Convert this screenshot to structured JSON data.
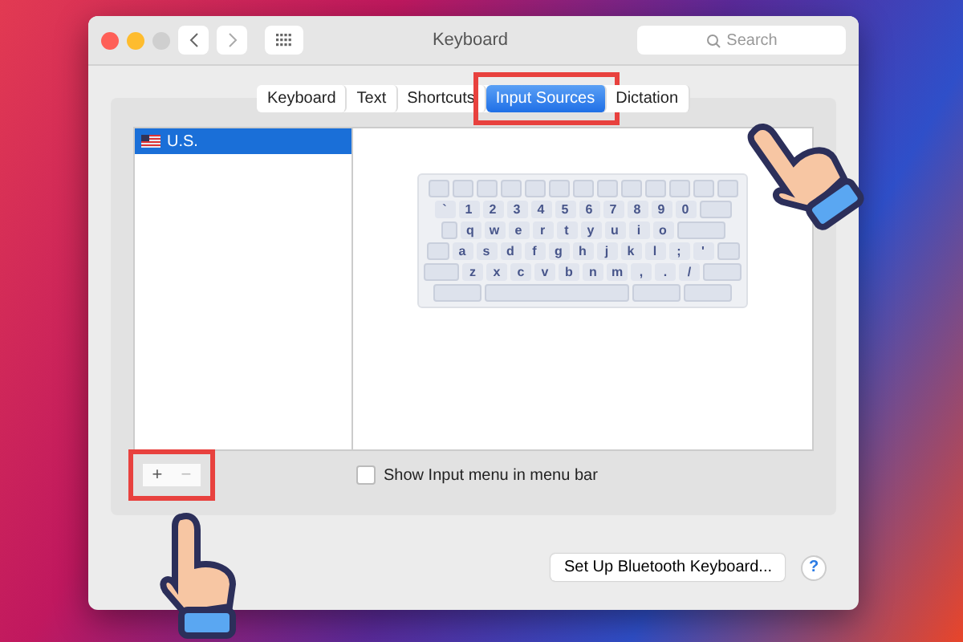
{
  "window": {
    "title": "Keyboard",
    "search": {
      "placeholder": "Search"
    }
  },
  "tabs": [
    {
      "label": "Keyboard",
      "selected": false,
      "highlighted": false
    },
    {
      "label": "Text",
      "selected": false,
      "highlighted": false
    },
    {
      "label": "Shortcuts",
      "selected": false,
      "highlighted": false
    },
    {
      "label": "Input Sources",
      "selected": true,
      "highlighted": true
    },
    {
      "label": "Dictation",
      "selected": false,
      "highlighted": false
    }
  ],
  "sources": [
    {
      "label": "U.S.",
      "selected": true
    }
  ],
  "keyboard_rows": [
    [
      "`",
      "1",
      "2",
      "3",
      "4",
      "5",
      "6",
      "7",
      "8",
      "9",
      "0"
    ],
    [
      "q",
      "w",
      "e",
      "r",
      "t",
      "y",
      "u",
      "i",
      "o"
    ],
    [
      "a",
      "s",
      "d",
      "f",
      "g",
      "h",
      "j",
      "k",
      "l",
      ";",
      "'"
    ],
    [
      "z",
      "x",
      "c",
      "v",
      "b",
      "n",
      "m",
      ",",
      ".",
      "/"
    ]
  ],
  "add_remove": {
    "add": "+",
    "remove": "−",
    "highlighted": true
  },
  "show_input_menu": {
    "label": "Show Input menu in menu bar",
    "checked": false
  },
  "bluetooth_button": "Set Up Bluetooth Keyboard...",
  "help": "?"
}
